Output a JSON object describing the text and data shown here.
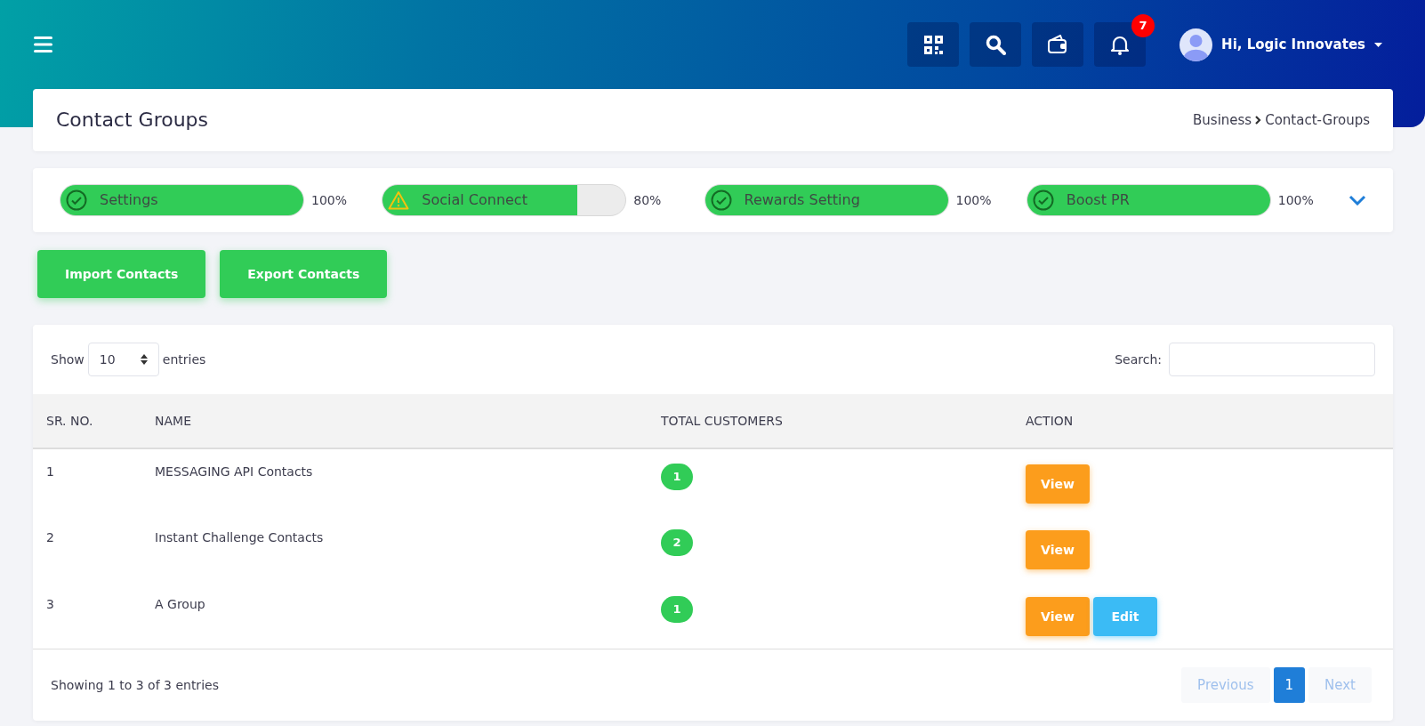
{
  "header": {
    "notification_count": "7",
    "user_greeting": "Hi, Logic Innovates"
  },
  "page": {
    "title": "Contact Groups",
    "breadcrumb": [
      "Business",
      "Contact-Groups"
    ]
  },
  "progress": [
    {
      "label": "Settings",
      "kind": "complete",
      "level": 1,
      "reading": "100%"
    },
    {
      "label": "Social Connect",
      "kind": "warning",
      "level": 0.8,
      "reading": "80%"
    },
    {
      "label": "Rewards Setting",
      "kind": "complete",
      "level": 1,
      "reading": "100%"
    },
    {
      "label": "Boost PR",
      "kind": "complete",
      "level": 1,
      "reading": "100%"
    }
  ],
  "actions": [
    "Import Contacts",
    "Export Contacts"
  ],
  "table": {
    "length_label_before": "Show",
    "length_value": "10",
    "length_label_after": "entries",
    "search_label": "Search:",
    "columns": [
      "SR. NO.",
      "NAME",
      "TOTAL CUSTOMERS",
      "ACTION"
    ],
    "rows": [
      {
        "sr": "1",
        "name": "MESSAGING API Contacts",
        "total": "1",
        "buttons": [
          {
            "kind": "view",
            "label": "View"
          }
        ]
      },
      {
        "sr": "2",
        "name": "Instant Challenge Contacts",
        "total": "2",
        "buttons": [
          {
            "kind": "view",
            "label": "View"
          }
        ]
      },
      {
        "sr": "3",
        "name": "A Group",
        "total": "1",
        "buttons": [
          {
            "kind": "view",
            "label": "View"
          },
          {
            "kind": "edit",
            "label": "Edit"
          }
        ]
      }
    ],
    "info": "Showing 1 to 3 of 3 entries",
    "pagination": [
      {
        "label": "Previous",
        "disabled": true,
        "selected": false
      },
      {
        "label": "1",
        "disabled": false,
        "selected": true
      },
      {
        "label": "Next",
        "disabled": true,
        "selected": false
      }
    ]
  }
}
